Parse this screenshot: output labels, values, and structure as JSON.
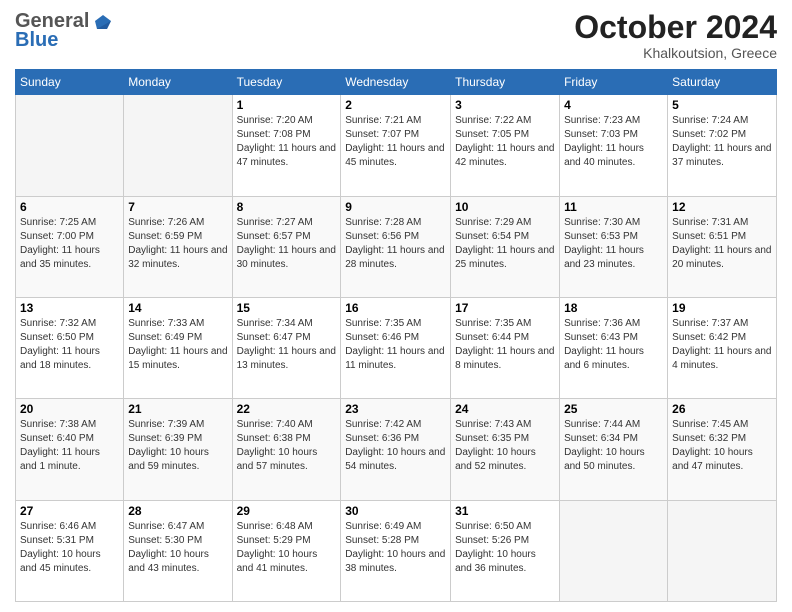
{
  "header": {
    "logo_general": "General",
    "logo_blue": "Blue",
    "month_title": "October 2024",
    "location": "Khalkoutsion, Greece"
  },
  "days_of_week": [
    "Sunday",
    "Monday",
    "Tuesday",
    "Wednesday",
    "Thursday",
    "Friday",
    "Saturday"
  ],
  "weeks": [
    [
      {
        "day": "",
        "empty": true
      },
      {
        "day": "",
        "empty": true
      },
      {
        "day": "1",
        "info": "Sunrise: 7:20 AM\nSunset: 7:08 PM\nDaylight: 11 hours and 47 minutes."
      },
      {
        "day": "2",
        "info": "Sunrise: 7:21 AM\nSunset: 7:07 PM\nDaylight: 11 hours and 45 minutes."
      },
      {
        "day": "3",
        "info": "Sunrise: 7:22 AM\nSunset: 7:05 PM\nDaylight: 11 hours and 42 minutes."
      },
      {
        "day": "4",
        "info": "Sunrise: 7:23 AM\nSunset: 7:03 PM\nDaylight: 11 hours and 40 minutes."
      },
      {
        "day": "5",
        "info": "Sunrise: 7:24 AM\nSunset: 7:02 PM\nDaylight: 11 hours and 37 minutes."
      }
    ],
    [
      {
        "day": "6",
        "info": "Sunrise: 7:25 AM\nSunset: 7:00 PM\nDaylight: 11 hours and 35 minutes."
      },
      {
        "day": "7",
        "info": "Sunrise: 7:26 AM\nSunset: 6:59 PM\nDaylight: 11 hours and 32 minutes."
      },
      {
        "day": "8",
        "info": "Sunrise: 7:27 AM\nSunset: 6:57 PM\nDaylight: 11 hours and 30 minutes."
      },
      {
        "day": "9",
        "info": "Sunrise: 7:28 AM\nSunset: 6:56 PM\nDaylight: 11 hours and 28 minutes."
      },
      {
        "day": "10",
        "info": "Sunrise: 7:29 AM\nSunset: 6:54 PM\nDaylight: 11 hours and 25 minutes."
      },
      {
        "day": "11",
        "info": "Sunrise: 7:30 AM\nSunset: 6:53 PM\nDaylight: 11 hours and 23 minutes."
      },
      {
        "day": "12",
        "info": "Sunrise: 7:31 AM\nSunset: 6:51 PM\nDaylight: 11 hours and 20 minutes."
      }
    ],
    [
      {
        "day": "13",
        "info": "Sunrise: 7:32 AM\nSunset: 6:50 PM\nDaylight: 11 hours and 18 minutes."
      },
      {
        "day": "14",
        "info": "Sunrise: 7:33 AM\nSunset: 6:49 PM\nDaylight: 11 hours and 15 minutes."
      },
      {
        "day": "15",
        "info": "Sunrise: 7:34 AM\nSunset: 6:47 PM\nDaylight: 11 hours and 13 minutes."
      },
      {
        "day": "16",
        "info": "Sunrise: 7:35 AM\nSunset: 6:46 PM\nDaylight: 11 hours and 11 minutes."
      },
      {
        "day": "17",
        "info": "Sunrise: 7:35 AM\nSunset: 6:44 PM\nDaylight: 11 hours and 8 minutes."
      },
      {
        "day": "18",
        "info": "Sunrise: 7:36 AM\nSunset: 6:43 PM\nDaylight: 11 hours and 6 minutes."
      },
      {
        "day": "19",
        "info": "Sunrise: 7:37 AM\nSunset: 6:42 PM\nDaylight: 11 hours and 4 minutes."
      }
    ],
    [
      {
        "day": "20",
        "info": "Sunrise: 7:38 AM\nSunset: 6:40 PM\nDaylight: 11 hours and 1 minute."
      },
      {
        "day": "21",
        "info": "Sunrise: 7:39 AM\nSunset: 6:39 PM\nDaylight: 10 hours and 59 minutes."
      },
      {
        "day": "22",
        "info": "Sunrise: 7:40 AM\nSunset: 6:38 PM\nDaylight: 10 hours and 57 minutes."
      },
      {
        "day": "23",
        "info": "Sunrise: 7:42 AM\nSunset: 6:36 PM\nDaylight: 10 hours and 54 minutes."
      },
      {
        "day": "24",
        "info": "Sunrise: 7:43 AM\nSunset: 6:35 PM\nDaylight: 10 hours and 52 minutes."
      },
      {
        "day": "25",
        "info": "Sunrise: 7:44 AM\nSunset: 6:34 PM\nDaylight: 10 hours and 50 minutes."
      },
      {
        "day": "26",
        "info": "Sunrise: 7:45 AM\nSunset: 6:32 PM\nDaylight: 10 hours and 47 minutes."
      }
    ],
    [
      {
        "day": "27",
        "info": "Sunrise: 6:46 AM\nSunset: 5:31 PM\nDaylight: 10 hours and 45 minutes."
      },
      {
        "day": "28",
        "info": "Sunrise: 6:47 AM\nSunset: 5:30 PM\nDaylight: 10 hours and 43 minutes."
      },
      {
        "day": "29",
        "info": "Sunrise: 6:48 AM\nSunset: 5:29 PM\nDaylight: 10 hours and 41 minutes."
      },
      {
        "day": "30",
        "info": "Sunrise: 6:49 AM\nSunset: 5:28 PM\nDaylight: 10 hours and 38 minutes."
      },
      {
        "day": "31",
        "info": "Sunrise: 6:50 AM\nSunset: 5:26 PM\nDaylight: 10 hours and 36 minutes."
      },
      {
        "day": "",
        "empty": true
      },
      {
        "day": "",
        "empty": true
      }
    ]
  ]
}
